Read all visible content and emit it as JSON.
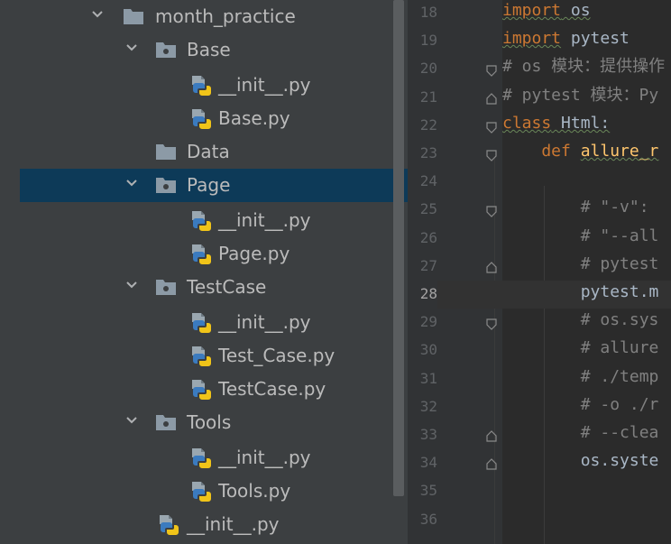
{
  "project_tree": {
    "items": [
      {
        "label": "month_practice",
        "type": "folder",
        "expanded": true
      },
      {
        "label": "Base",
        "type": "package",
        "expanded": true
      },
      {
        "label": "__init__.py",
        "type": "python"
      },
      {
        "label": "Base.py",
        "type": "python"
      },
      {
        "label": "Data",
        "type": "folder"
      },
      {
        "label": "Page",
        "type": "package",
        "expanded": true,
        "selected": true
      },
      {
        "label": "__init__.py",
        "type": "python"
      },
      {
        "label": "Page.py",
        "type": "python"
      },
      {
        "label": "TestCase",
        "type": "package",
        "expanded": true
      },
      {
        "label": "__init__.py",
        "type": "python"
      },
      {
        "label": "Test_Case.py",
        "type": "python"
      },
      {
        "label": "TestCase.py",
        "type": "python"
      },
      {
        "label": "Tools",
        "type": "package",
        "expanded": true
      },
      {
        "label": "__init__.py",
        "type": "python"
      },
      {
        "label": "Tools.py",
        "type": "python"
      },
      {
        "label": "__init__.py",
        "type": "python"
      }
    ]
  },
  "editor": {
    "current_line": "28",
    "lines": [
      {
        "num": "18",
        "parts": [
          {
            "t": "import",
            "c": "kw squig"
          },
          {
            "t": " os",
            "c": "squig"
          }
        ]
      },
      {
        "num": "19",
        "parts": [
          {
            "t": "import",
            "c": "kw squig"
          },
          {
            "t": " pytest",
            "c": ""
          }
        ]
      },
      {
        "num": "20",
        "parts": [
          {
            "t": "# os 模块：提供操作",
            "c": "cm"
          }
        ]
      },
      {
        "num": "21",
        "parts": [
          {
            "t": "# pytest 模块：Py",
            "c": "cm"
          }
        ]
      },
      {
        "num": "22",
        "parts": [
          {
            "t": "class",
            "c": "kw squig"
          },
          {
            "t": " Html:",
            "c": "squig"
          }
        ]
      },
      {
        "num": "23",
        "parts": [
          {
            "t": "    def ",
            "c": "kw"
          },
          {
            "t": "allure_r",
            "c": "fn squig"
          }
        ]
      },
      {
        "num": "24",
        "parts": []
      },
      {
        "num": "25",
        "parts": [
          {
            "t": "        # \"-v\":",
            "c": "cm"
          }
        ]
      },
      {
        "num": "26",
        "parts": [
          {
            "t": "        # \"--all",
            "c": "cm"
          }
        ]
      },
      {
        "num": "27",
        "parts": [
          {
            "t": "        # pytest",
            "c": "cm"
          }
        ]
      },
      {
        "num": "28",
        "parts": [
          {
            "t": "        pytest.m",
            "c": ""
          }
        ]
      },
      {
        "num": "29",
        "parts": [
          {
            "t": "        # os.sys",
            "c": "cm"
          }
        ]
      },
      {
        "num": "30",
        "parts": [
          {
            "t": "        # allure",
            "c": "cm"
          }
        ]
      },
      {
        "num": "31",
        "parts": [
          {
            "t": "        # ./temp",
            "c": "cm"
          }
        ]
      },
      {
        "num": "32",
        "parts": [
          {
            "t": "        # -o ./r",
            "c": "cm"
          }
        ]
      },
      {
        "num": "33",
        "parts": [
          {
            "t": "        # --clea",
            "c": "cm"
          }
        ]
      },
      {
        "num": "34",
        "parts": [
          {
            "t": "        os.syste",
            "c": ""
          }
        ]
      },
      {
        "num": "35",
        "parts": []
      },
      {
        "num": "36",
        "parts": []
      }
    ]
  }
}
